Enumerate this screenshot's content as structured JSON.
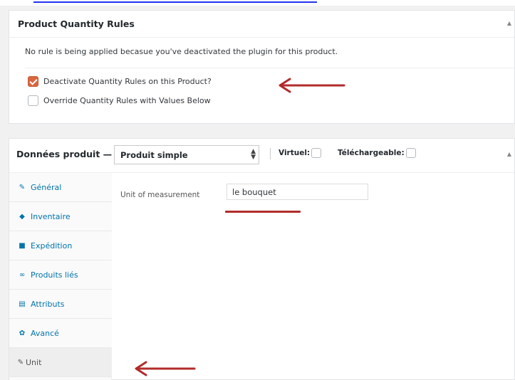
{
  "colors": {
    "accent_link": "#0073aa",
    "checkbox_checked": "#d9663f",
    "annotation_red": "#b22b2b"
  },
  "quantity_rules": {
    "title": "Product Quantity Rules",
    "notice": "No rule is being applied becasue you've deactivated the plugin for this product.",
    "checkboxes": [
      {
        "label": "Deactivate Quantity Rules on this Product?",
        "checked": true
      },
      {
        "label": "Override Quantity Rules with Values Below",
        "checked": false
      }
    ]
  },
  "product_data": {
    "title": "Données produit —",
    "product_type": "Produit simple",
    "virtual_label": "Virtuel:",
    "downloadable_label": "Téléchargeable:",
    "tabs": [
      {
        "label": "Général",
        "icon": "wrench-icon"
      },
      {
        "label": "Inventaire",
        "icon": "tag-icon"
      },
      {
        "label": "Expédition",
        "icon": "truck-icon"
      },
      {
        "label": "Produits liés",
        "icon": "link-icon"
      },
      {
        "label": "Attributs",
        "icon": "list-icon"
      },
      {
        "label": "Avancé",
        "icon": "gear-icon"
      },
      {
        "label": "Unit",
        "icon": "wrench-icon",
        "active": true
      }
    ],
    "unit_field": {
      "label": "Unit of measurement",
      "value": "le bouquet"
    }
  }
}
